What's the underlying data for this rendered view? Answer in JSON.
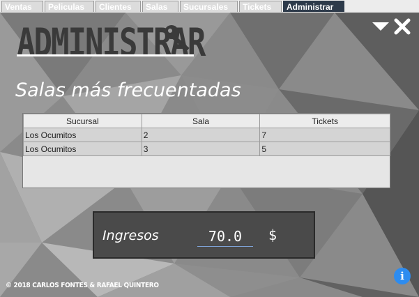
{
  "tabs": [
    "Ventas",
    "Peliculas",
    "Clientes",
    "Salas",
    "Sucursales",
    "Tickets",
    "Administrar"
  ],
  "active_tab": "Administrar",
  "header": {
    "title": "ADMINISTRAR",
    "icon": "key-icon"
  },
  "window_controls": {
    "minimize_icon": "triangle-down-icon",
    "close_icon": "close-icon"
  },
  "section_heading": "Salas más frecuentadas",
  "table": {
    "columns": [
      "Sucursal",
      "Sala",
      "Tickets"
    ],
    "rows": [
      [
        "Los Ocumitos",
        "2",
        "7"
      ],
      [
        "Los Ocumitos",
        "3",
        "5"
      ]
    ]
  },
  "income": {
    "label": "Ingresos",
    "value": "70.0",
    "currency": "$"
  },
  "footer": {
    "copyright": "© 2018 CARLOS FONTES & RAFAEL QUINTERO",
    "info_icon": "info-icon",
    "info_glyph": "i"
  },
  "colors": {
    "active_tab": "#2d3a4a",
    "info": "#2d8cf0",
    "income_bg": "#4a4a4a"
  }
}
